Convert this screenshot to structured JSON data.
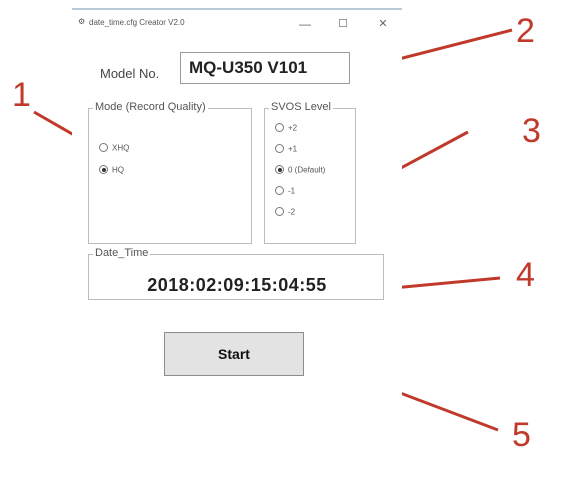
{
  "window": {
    "title": "date_time.cfg Creator V2.0",
    "icon": "app-icon",
    "controls": {
      "minimize": "—",
      "maximize": "☐",
      "close": "✕"
    }
  },
  "model": {
    "label": "Model No.",
    "value": "MQ-U350 V101"
  },
  "mode_group": {
    "legend": "Mode (Record Quality)",
    "options": [
      {
        "label": "XHQ",
        "checked": false
      },
      {
        "label": "HQ",
        "checked": true
      }
    ]
  },
  "svos_group": {
    "legend": "SVOS Level",
    "options": [
      {
        "label": "+2",
        "checked": false
      },
      {
        "label": "+1",
        "checked": false
      },
      {
        "label": "0 (Default)",
        "checked": true
      },
      {
        "label": "-1",
        "checked": false
      },
      {
        "label": "-2",
        "checked": false
      }
    ]
  },
  "datetime": {
    "legend": "Date_Time",
    "value": "2018:02:09:15:04:55"
  },
  "start_button": {
    "label": "Start"
  },
  "callouts": [
    "1",
    "2",
    "3",
    "4",
    "5"
  ],
  "colors": {
    "annotation": "#c0392b",
    "button_face": "#e3e3e3",
    "title_accent": "#b9cbd8"
  }
}
